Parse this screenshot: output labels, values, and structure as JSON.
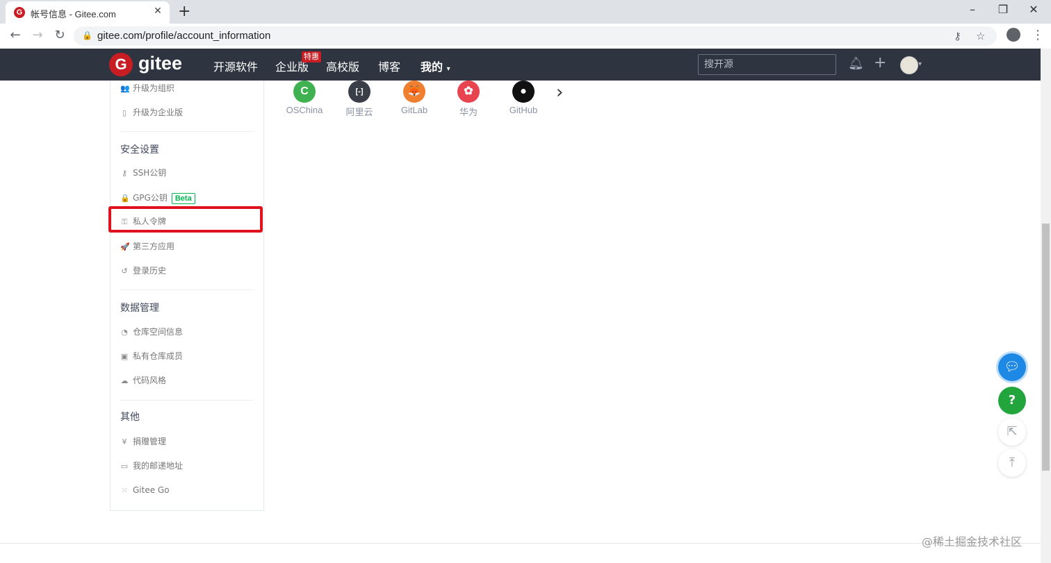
{
  "browser": {
    "tab_title": "帐号信息 - Gitee.com",
    "tab_favicon": "G",
    "tab_close": "✕",
    "new_tab": "+",
    "url": "gitee.com/profile/account_information",
    "window_controls": [
      "–",
      "❐",
      "✕"
    ]
  },
  "header": {
    "logo_mark": "G",
    "logo_text": "gitee",
    "nav": [
      "开源软件",
      "企业版",
      "高校版",
      "博客",
      "我的"
    ],
    "badge": "特惠",
    "my_caret": "▾",
    "search_placeholder": "搜开源"
  },
  "providers": [
    {
      "label": "OSChina",
      "glyph": "C",
      "color": "#3fb150"
    },
    {
      "label": "阿里云",
      "glyph": "[-]",
      "color": "#3a3e47"
    },
    {
      "label": "GitLab",
      "glyph": "🦊",
      "color": "#f0802f"
    },
    {
      "label": "华为",
      "glyph": "✿",
      "color": "#e84450"
    },
    {
      "label": "GitHub",
      "glyph": "●",
      "color": "#111111"
    }
  ],
  "provider_next": "›",
  "sidebar": {
    "top_items": [
      {
        "icon": "users-icon",
        "glyph": "👥",
        "label": "升级为组织"
      },
      {
        "icon": "building-icon",
        "glyph": "▯",
        "label": "升级为企业版"
      }
    ],
    "security_heading": "安全设置",
    "security_items": [
      {
        "icon": "key-icon",
        "glyph": "⚷",
        "label": "SSH公钥"
      },
      {
        "icon": "lock-icon",
        "glyph": "🔒",
        "label": "GPG公钥",
        "badge": "Beta"
      },
      {
        "icon": "token-icon",
        "glyph": "⚿",
        "label": "私人令牌"
      },
      {
        "icon": "rocket-icon",
        "glyph": "🚀",
        "label": "第三方应用"
      },
      {
        "icon": "history-icon",
        "glyph": "↺",
        "label": "登录历史"
      }
    ],
    "data_heading": "数据管理",
    "data_items": [
      {
        "icon": "pie-icon",
        "glyph": "◔",
        "label": "仓库空间信息"
      },
      {
        "icon": "member-icon",
        "glyph": "▣",
        "label": "私有仓库成员"
      },
      {
        "icon": "code-style-icon",
        "glyph": "☁",
        "label": "代码风格"
      }
    ],
    "other_heading": "其他",
    "other_items": [
      {
        "icon": "yen-icon",
        "glyph": "¥",
        "label": "捐赠管理"
      },
      {
        "icon": "id-card-icon",
        "glyph": "▭",
        "label": "我的邮递地址"
      },
      {
        "icon": "gitee-go-icon",
        "glyph": "⁙",
        "label": "Gitee Go"
      }
    ]
  },
  "floating": {
    "help": "?",
    "share": "⇱",
    "top": "⤒"
  },
  "watermark": "@稀土掘金技术社区"
}
